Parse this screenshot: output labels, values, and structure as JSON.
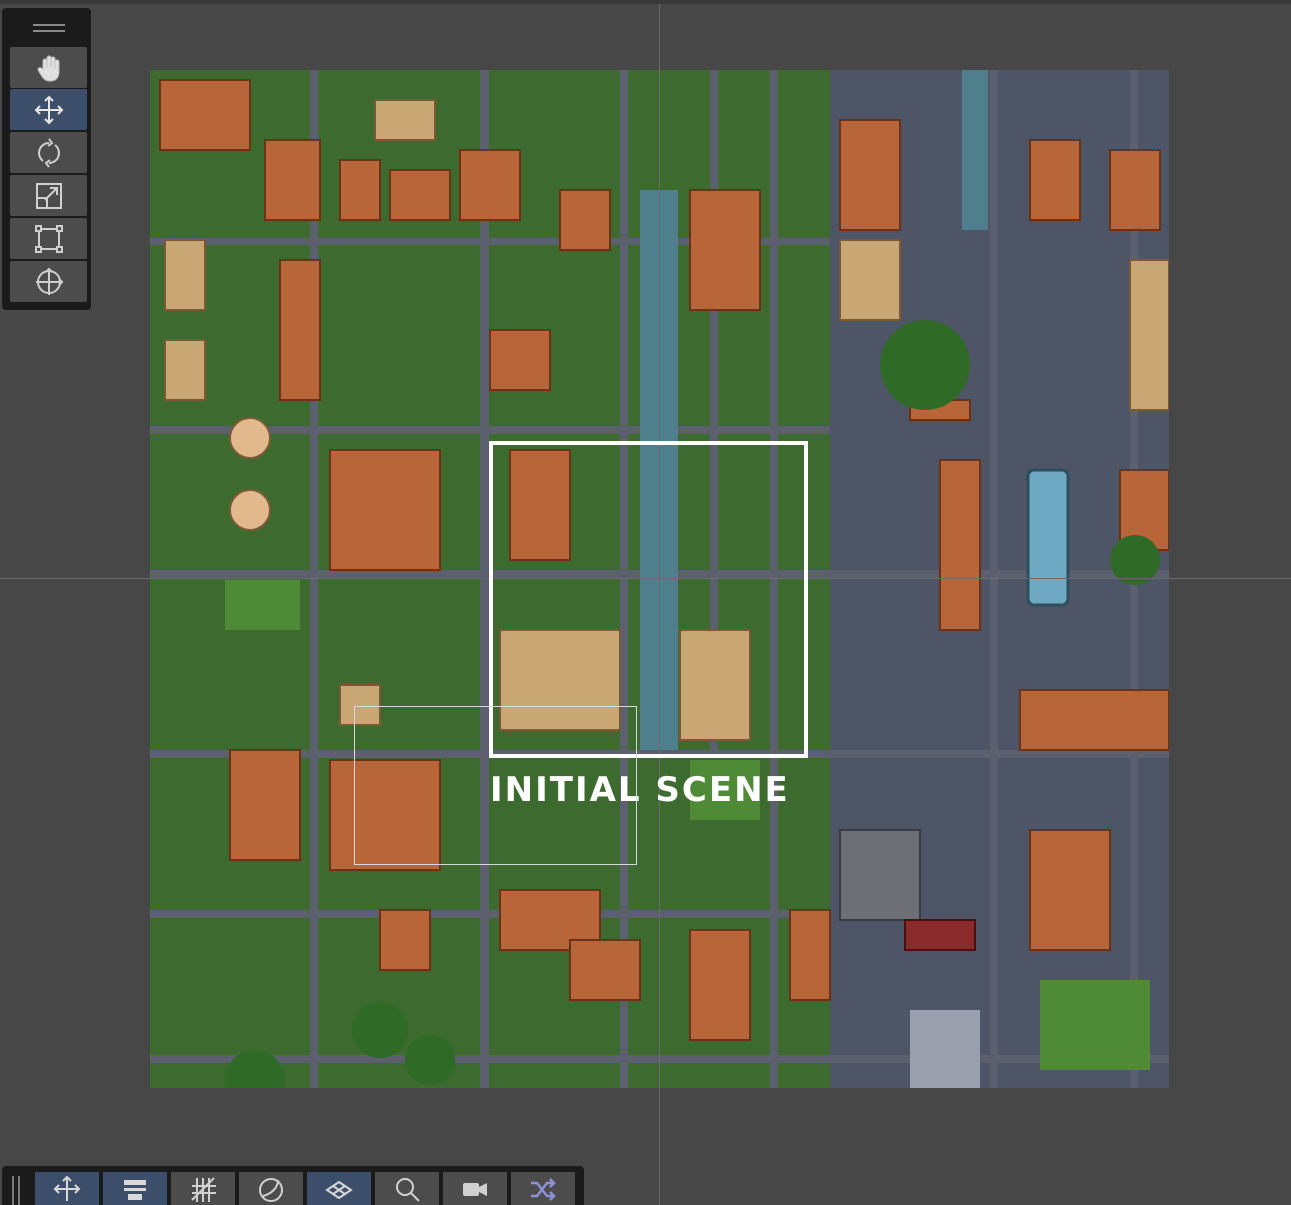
{
  "scene": {
    "label": "INITIAL SCENE"
  },
  "toolbar_left": {
    "tools": [
      {
        "name": "hand-tool-button",
        "icon": "hand-icon",
        "active": false
      },
      {
        "name": "move-tool-button",
        "icon": "move-arrows-icon",
        "active": true
      },
      {
        "name": "rotate-tool-button",
        "icon": "rotate-icon",
        "active": false
      },
      {
        "name": "scale-tool-button",
        "icon": "scale-icon",
        "active": false
      },
      {
        "name": "rect-tool-button",
        "icon": "rect-transform-icon",
        "active": false
      },
      {
        "name": "transform-tool-button",
        "icon": "transform-icon",
        "active": false
      }
    ]
  },
  "toolbar_bottom": {
    "tools": [
      {
        "name": "move-snap-button",
        "icon": "move-arrows-icon"
      },
      {
        "name": "align-button",
        "icon": "align-icon"
      },
      {
        "name": "grid-button",
        "icon": "grid-icon"
      },
      {
        "name": "shading-button",
        "icon": "sphere-shading-icon"
      },
      {
        "name": "layers-button",
        "icon": "layers-icon"
      },
      {
        "name": "search-button",
        "icon": "search-icon"
      },
      {
        "name": "camera-button",
        "icon": "video-camera-icon"
      },
      {
        "name": "random-button",
        "icon": "shuffle-icon"
      }
    ]
  },
  "colors": {
    "background": "#474747",
    "toolbar": "#1b1b1b",
    "button": "#4c4c4c",
    "active_button": "#3d4e6a",
    "icon": "#d0d0d0",
    "accent_icon": "#8d8fd8"
  }
}
